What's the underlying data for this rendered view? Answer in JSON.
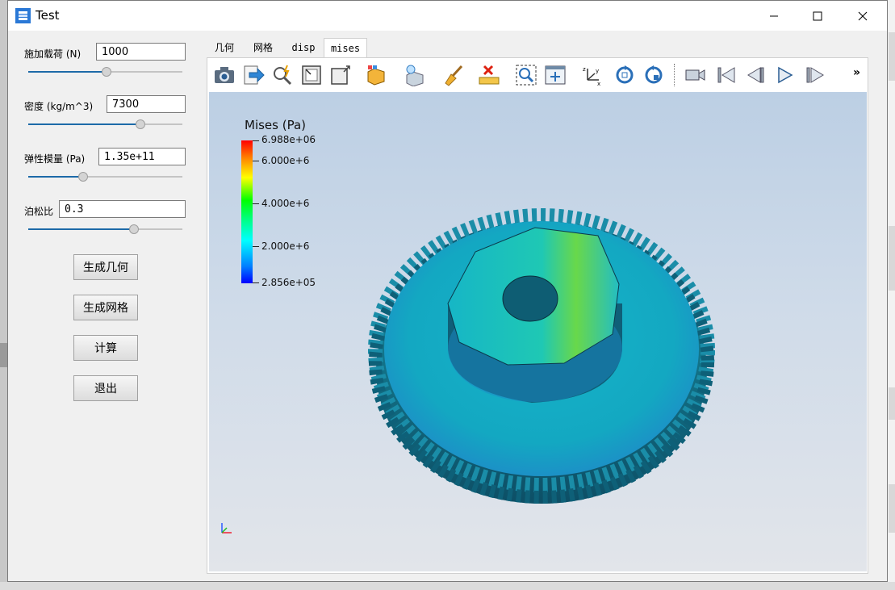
{
  "window": {
    "title": "Test"
  },
  "params": [
    {
      "label": "施加载荷 (N)",
      "value": "1000",
      "slider": 0.5
    },
    {
      "label": "密度 (kg/m^3)",
      "value": "7300",
      "slider": 0.72
    },
    {
      "label": "弹性模量 (Pa)",
      "value": "1.35e+11",
      "slider": 0.35
    },
    {
      "label": "泊松比",
      "value": "0.3",
      "slider": 0.68
    }
  ],
  "buttons": {
    "gen_geometry": "生成几何",
    "gen_mesh": "生成网格",
    "compute": "计算",
    "exit": "退出"
  },
  "tabs": [
    {
      "label": "几何"
    },
    {
      "label": "网格"
    },
    {
      "label": "disp"
    },
    {
      "label": "mises",
      "active": true
    }
  ],
  "toolbar": {
    "icons": [
      "camera-icon",
      "export-icon",
      "query-icon",
      "frame-icon",
      "box-icon",
      "render-options-icon",
      "light-icon",
      "clear-icon",
      "ruler-icon",
      "zoom-box-icon",
      "fit-view-icon",
      "axes-orient-icon",
      "rotate-cw-icon",
      "rotate-ccw-icon",
      "video-icon",
      "first-frame-icon",
      "prev-frame-icon",
      "play-icon",
      "last-frame-icon"
    ],
    "overflow_label": "»"
  },
  "legend": {
    "title": "Mises (Pa)",
    "ticks": [
      "6.988e+06",
      "6.000e+6",
      "4.000e+6",
      "2.000e+6",
      "2.856e+05"
    ],
    "colors": {
      "min": "#0000ff",
      "mid": "#00ff00",
      "max": "#ff0000"
    }
  }
}
